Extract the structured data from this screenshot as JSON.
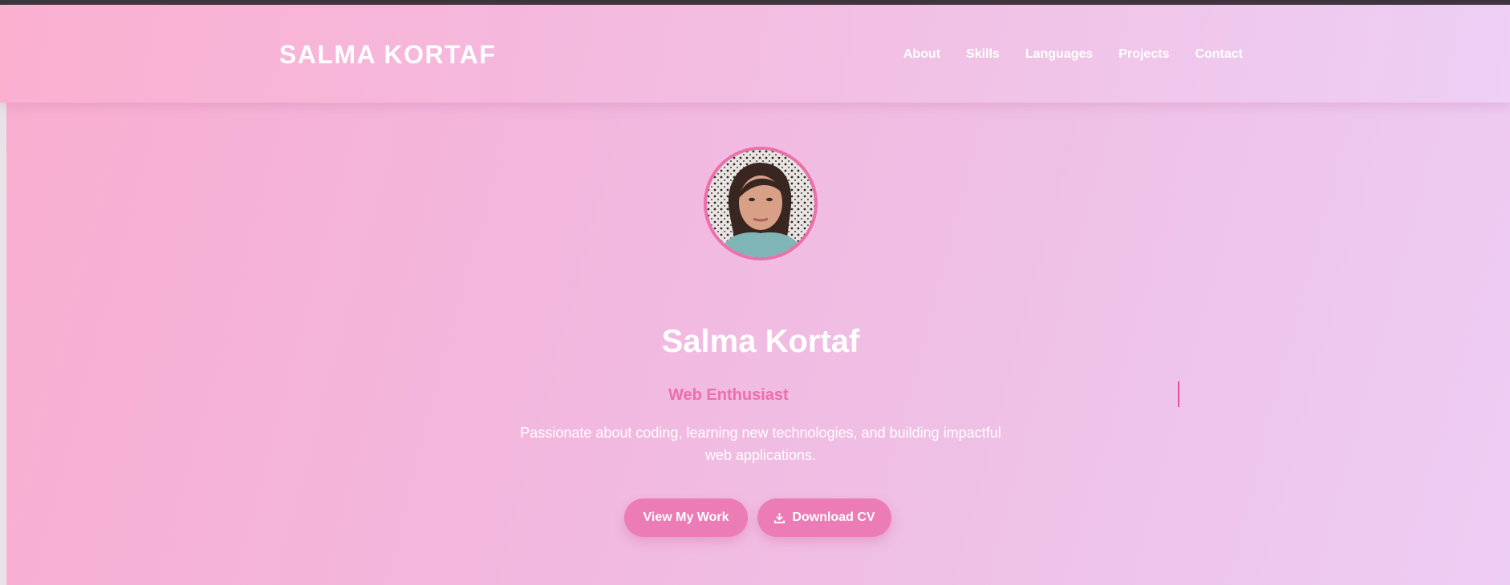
{
  "header": {
    "logo": "SALMA KORTAF",
    "nav": [
      "About",
      "Skills",
      "Languages",
      "Projects",
      "Contact"
    ]
  },
  "hero": {
    "name": "Salma Kortaf",
    "role": "Web Enthusiast",
    "description": "Passionate about coding, learning new technologies, and building impactful web applications.",
    "buttons": {
      "work_label": "View My Work",
      "cv_label": "Download CV"
    }
  },
  "colors": {
    "accent": "#ec6fab",
    "button": "#ec7cb6",
    "background_start": "#f9aecf",
    "background_end": "#eecdf4"
  },
  "icons": {
    "download": "download-icon"
  }
}
